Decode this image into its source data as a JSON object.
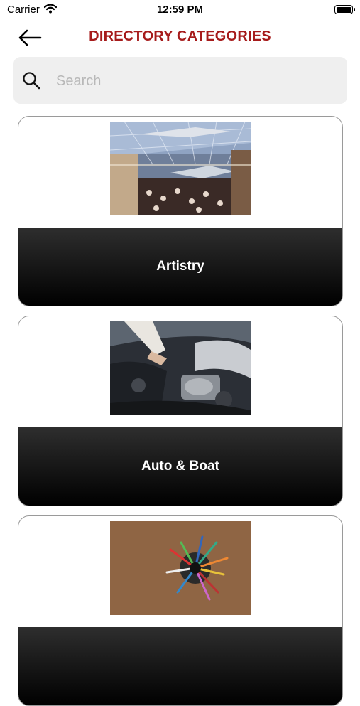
{
  "status_bar": {
    "carrier": "Carrier",
    "time": "12:59 PM",
    "wifi_icon": "wifi-icon",
    "battery_icon": "battery-icon"
  },
  "header": {
    "back_icon": "arrow-left-icon",
    "title": "DIRECTORY CATEGORIES",
    "title_color": "#a61b1b"
  },
  "search": {
    "placeholder": "Search",
    "value": "",
    "icon": "search-icon"
  },
  "categories": [
    {
      "label": "Artistry",
      "image": "museum-hall-photo"
    },
    {
      "label": "Auto & Boat",
      "image": "car-engine-photo"
    },
    {
      "label": "",
      "image": "pencil-cup-photo"
    }
  ]
}
